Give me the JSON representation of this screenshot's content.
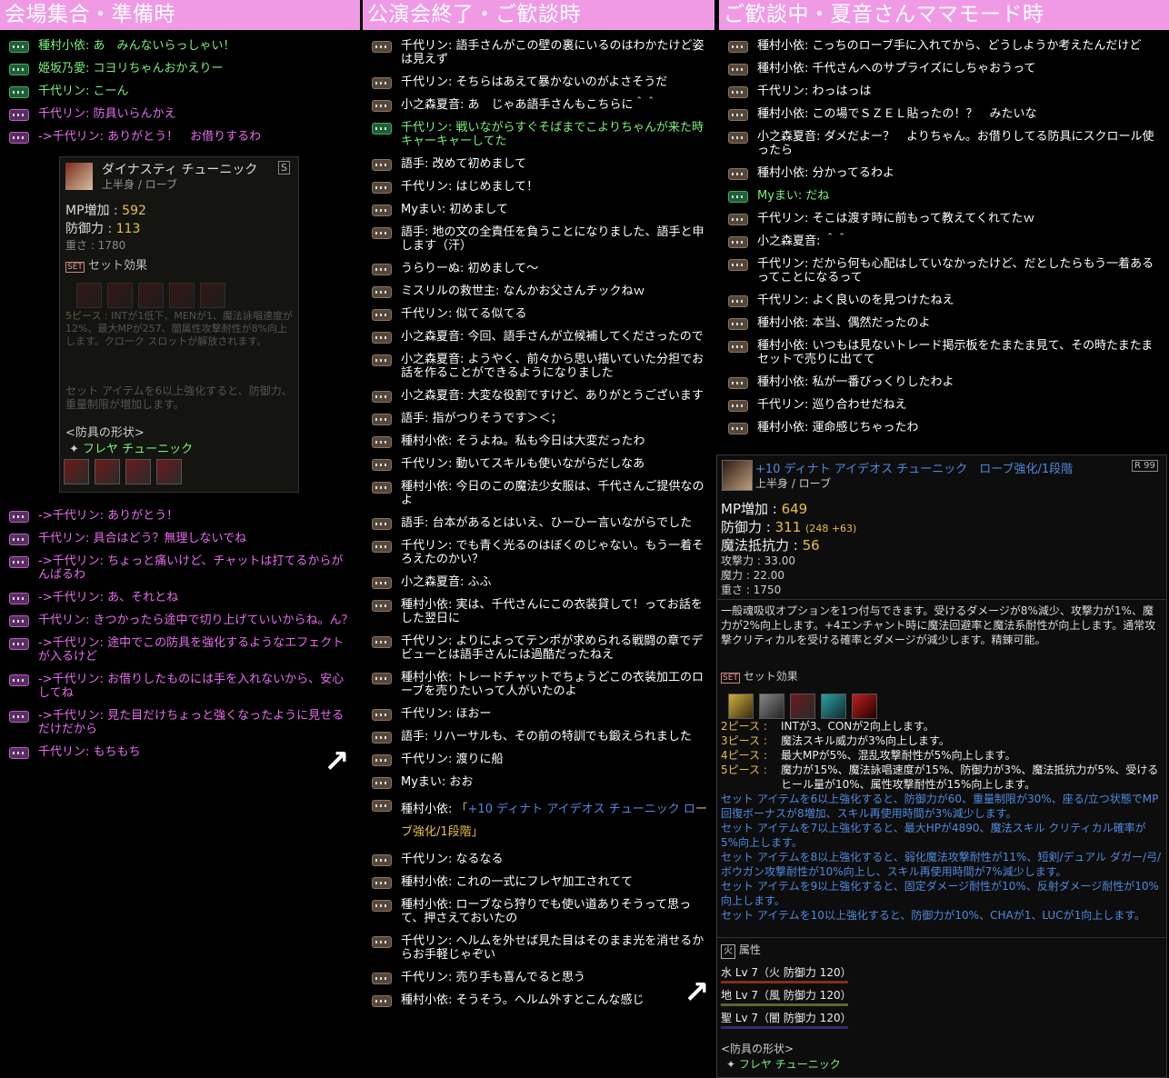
{
  "columns": [
    {
      "header": "会場集合・準備時",
      "messages_top": [
        {
          "icon": "g",
          "color": "green",
          "text": "種村小依: あ　みんないらっしゃい！"
        },
        {
          "icon": "g",
          "color": "green",
          "text": "姫坂乃愛: コヨリちゃんおかえりー"
        },
        {
          "icon": "g",
          "color": "green",
          "text": "千代リン: こーん"
        },
        {
          "icon": "p",
          "color": "pink",
          "text": "千代リン: 防具いらんかえ"
        },
        {
          "icon": "p",
          "color": "pink",
          "text": "->千代リン: ありがとう！　お借りするわ"
        }
      ],
      "messages_bottom": [
        {
          "icon": "p",
          "color": "pink",
          "text": "->千代リン: ありがとう！"
        },
        {
          "icon": "p",
          "color": "pink",
          "text": "千代リン: 具合はどう？無理しないでね"
        },
        {
          "icon": "p",
          "color": "pink",
          "text": "->千代リン: ちょっと痛いけど、チャットは打てるからがんばるわ"
        },
        {
          "icon": "p",
          "color": "pink",
          "text": "->千代リン: あ、それとね"
        },
        {
          "icon": "p",
          "color": "pink",
          "text": "千代リン: きつかったら途中で切り上げていいからね。ん？"
        },
        {
          "icon": "p",
          "color": "pink",
          "text": "->千代リン: 途中でこの防具を強化するようなエフェクトが入るけど"
        },
        {
          "icon": "p",
          "color": "pink",
          "text": "->千代リン: お借りしたものには手を入れないから、安心してね"
        },
        {
          "icon": "p",
          "color": "pink",
          "text": "->千代リン: 見た目だけちょっと強くなったように見せるだけだから"
        },
        {
          "icon": "p",
          "color": "pink",
          "text": "千代リン: もちもち"
        }
      ]
    },
    {
      "header": "公演会終了・ご歓談時",
      "messages": [
        {
          "icon": "w",
          "color": "white",
          "text": "千代リン: 語手さんがこの壁の裏にいるのはわかたけど姿は見えず"
        },
        {
          "icon": "w",
          "color": "white",
          "text": "千代リン: そちらはあえて暴かないのがよさそうだ"
        },
        {
          "icon": "w",
          "color": "white",
          "text": "小之森夏音: あ　じゃあ語手さんもこちらに＾＾"
        },
        {
          "icon": "g",
          "color": "green",
          "text": "千代リン: 戦いながらすぐそばまでこよりちゃんが来た時キャーキャーしてた"
        },
        {
          "icon": "w",
          "color": "white",
          "text": "語手: 改めて初めまして"
        },
        {
          "icon": "w",
          "color": "white",
          "text": "千代リン: はじめまして！"
        },
        {
          "icon": "w",
          "color": "white",
          "text": "Myまい: 初めまして"
        },
        {
          "icon": "w",
          "color": "white",
          "text": "語手: 地の文の全責任を負うことになりました、語手と申します（汗）"
        },
        {
          "icon": "w",
          "color": "white",
          "text": "うらりーぬ: 初めまして〜"
        },
        {
          "icon": "w",
          "color": "white",
          "text": "ミスリルの救世主: なんかお父さんチックねｗ"
        },
        {
          "icon": "w",
          "color": "white",
          "text": "千代リン: 似てる似てる"
        },
        {
          "icon": "w",
          "color": "white",
          "text": "小之森夏音: 今回、語手さんが立候補してくださったので"
        },
        {
          "icon": "w",
          "color": "white",
          "text": "小之森夏音: ようやく、前々から思い描いていた分担でお話を作ることができるようになりました"
        },
        {
          "icon": "w",
          "color": "white",
          "text": "小之森夏音: 大変な役割ですけど、ありがとうございます"
        },
        {
          "icon": "w",
          "color": "white",
          "text": "語手: 指がつりそうです＞＜；"
        },
        {
          "icon": "w",
          "color": "white",
          "text": "種村小依: そうよね。私も今日は大変だったわ"
        },
        {
          "icon": "w",
          "color": "white",
          "text": "千代リン: 動いてスキルも使いながらだしなあ"
        },
        {
          "icon": "w",
          "color": "white",
          "text": "種村小依: 今日のこの魔法少女服は、千代さんご提供なのよ"
        },
        {
          "icon": "w",
          "color": "white",
          "text": "語手: 台本があるとはいえ、ひーひー言いながらでした"
        },
        {
          "icon": "w",
          "color": "white",
          "text": "千代リン: でも青く光るのはぼくのじゃない。もう一着そろえたのかい？"
        },
        {
          "icon": "w",
          "color": "white",
          "text": "小之森夏音: ふふ"
        },
        {
          "icon": "w",
          "color": "white",
          "text": "種村小依: 実は、千代さんにこの衣装貸して！ってお話をした翌日に"
        },
        {
          "icon": "w",
          "color": "white",
          "text": "千代リン: よりによってテンポが求められる戦闘の章でデビューとは語手さんには過酷だったねえ"
        },
        {
          "icon": "w",
          "color": "white",
          "text": "種村小依: トレードチャットでちょうどこの衣装加工のローブを売りたいって人がいたのよ"
        },
        {
          "icon": "w",
          "color": "white",
          "text": "千代リン: ほおー"
        },
        {
          "icon": "w",
          "color": "white",
          "text": "語手: リハーサルも、その前の特訓でも鍛えられました"
        },
        {
          "icon": "w",
          "color": "white",
          "text": "千代リン: 渡りに船"
        },
        {
          "icon": "w",
          "color": "white",
          "text": "Myまい: おお"
        }
      ],
      "link_msg": {
        "prefix": "種村小依: ",
        "open": "「",
        "link1": "+10 ディナト アイデオス チューニック ロ",
        "link2": "ーブ強化/1段階",
        "close": "」"
      },
      "messages_after": [
        {
          "icon": "w",
          "color": "white",
          "text": "千代リン: なるなる"
        },
        {
          "icon": "w",
          "color": "white",
          "text": "種村小依: これの一式にフレヤ加工されてて"
        },
        {
          "icon": "w",
          "color": "white",
          "text": "種村小依: ローブなら狩りでも使い道ありそうって思って、押さえておいたの"
        },
        {
          "icon": "w",
          "color": "white",
          "text": "千代リン: ヘルムを外せば見た目はそのまま光を消せるからお手軽じゃぞい"
        },
        {
          "icon": "w",
          "color": "white",
          "text": "千代リン: 売り手も喜んでると思う"
        },
        {
          "icon": "w",
          "color": "white",
          "text": "種村小依: そうそう。ヘルム外すとこんな感じ"
        }
      ]
    },
    {
      "header": "ご歓談中・夏音さんママモード時",
      "messages": [
        {
          "icon": "w",
          "color": "white",
          "text": "種村小依: こっちのローブ手に入れてから、どうしようか考えたんだけど"
        },
        {
          "icon": "w",
          "color": "white",
          "text": "種村小依: 千代さんへのサプライズにしちゃおうって"
        },
        {
          "icon": "w",
          "color": "white",
          "text": "千代リン: わっはっは"
        },
        {
          "icon": "w",
          "color": "white",
          "text": "種村小依: この場でＳＺＥＬ貼ったの！？　みたいな"
        },
        {
          "icon": "w",
          "color": "white",
          "text": "小之森夏音: ダメだよー？　よりちゃん。お借りしてる防具にスクロール使ったら"
        },
        {
          "icon": "w",
          "color": "white",
          "text": "種村小依: 分かってるわよ"
        },
        {
          "icon": "g",
          "color": "green",
          "text": "Myまい: だね"
        },
        {
          "icon": "w",
          "color": "white",
          "text": "千代リン: そこは渡す時に前もって教えてくれてたｗ"
        },
        {
          "icon": "w",
          "color": "white",
          "text": "小之森夏音: ＾＾"
        },
        {
          "icon": "w",
          "color": "white",
          "text": "千代リン: だから何も心配はしていなかったけど、だとしたらもう一着あるってことになるって"
        },
        {
          "icon": "w",
          "color": "white",
          "text": "千代リン: よく良いのを見つけたねえ"
        },
        {
          "icon": "w",
          "color": "white",
          "text": "種村小依: 本当、偶然だったのよ"
        },
        {
          "icon": "w",
          "color": "white",
          "text": "種村小依: いつもは見ないトレード掲示板をたまたま見て、その時たまたまセットで売りに出てて"
        },
        {
          "icon": "w",
          "color": "white",
          "text": "種村小依: 私が一番びっくりしたわよ"
        },
        {
          "icon": "w",
          "color": "white",
          "text": "千代リン: 巡り合わせだねえ"
        },
        {
          "icon": "w",
          "color": "white",
          "text": "種村小依: 運命感じちゃったわ"
        }
      ]
    }
  ],
  "tooltip_left": {
    "name": "ダイナスティ チューニック",
    "badge": "S",
    "slot": "上半身 / ローブ",
    "stats": [
      {
        "label": "MP増加",
        "value": "592"
      },
      {
        "label": "防御力",
        "value": "113"
      }
    ],
    "weight": "重さ : 1780",
    "set_title": "セット効果",
    "piece_label": "5ピース :",
    "piece_text": "INTが1低下、MENが1、魔法詠唱速度が12%、最大MPが257、闇属性攻撃耐性が8%向上します。クローク スロットが解放されます。",
    "enhance_text": "セット アイテムを6以上強化すると、防御力、重量制限が増加します。",
    "shape_title": "<防具の形状>",
    "shape_name": "フレヤ チューニック"
  },
  "tooltip_right": {
    "name": "+10 ディナト アイデオス チューニック　ローブ強化/1段階",
    "badge": "R 99",
    "slot": "上半身 / ローブ",
    "stats_big": [
      {
        "label": "MP増加 :",
        "value": "649",
        "extra": ""
      },
      {
        "label": "防御力 :",
        "value": "311",
        "extra": "(248 +63)"
      },
      {
        "label": "魔法抵抗力 :",
        "value": "56",
        "extra": ""
      }
    ],
    "stats_small": [
      "攻撃力 : 33.00",
      "魔力 : 22.00",
      "重さ : 1750"
    ],
    "desc": "一般魂吸収オプションを1つ付与できます。受けるダメージが8%減少、攻撃力が1%、魔力が2%向上します。+4エンチャント時に魔法回避率と魔法系耐性が向上します。通常攻撃クリティカルを受ける確率とダメージが減少します。精錬可能。",
    "set_title": "セット効果",
    "pieces": [
      {
        "label": "2ピース :",
        "text": "INTが3、CONが2向上します。"
      },
      {
        "label": "3ピース :",
        "text": "魔法スキル威力が3%向上します。"
      },
      {
        "label": "4ピース :",
        "text": "最大MPが5%、混乱攻撃耐性が5%向上します。"
      },
      {
        "label": "5ピース :",
        "text": "魔力が15%、魔法詠唱速度が15%、防御力が3%、魔法抵抗力が5%、受けるヒール量が10%、属性攻撃耐性が15%向上します。"
      }
    ],
    "enhance": [
      "セット アイテムを6以上強化すると、防御力が60、重量制限が30%、座る/立つ状態でMP回復ボーナスが8増加、スキル再使用時間が3%減少します。",
      "セット アイテムを7以上強化すると、最大HPが4890、魔法スキル クリティカル確率が5%向上します。",
      "セット アイテムを8以上強化すると、弱化魔法攻撃耐性が11%、短剣/デュアル ダガー/弓/ボウガン攻撃耐性が10%向上し、スキル再使用時間が7%減少します。",
      "セット アイテムを9以上強化すると、固定ダメージ耐性が10%、反射ダメージ耐性が10%向上します。",
      "セット アイテムを10以上強化すると、防御力が10%、CHAが1、LUCが1向上します。"
    ],
    "attr_title": "属性",
    "attrs": [
      {
        "text": "水 Lv 7（火 防御力 120）",
        "color": "#8a2a1a"
      },
      {
        "text": "地 Lv 7（風 防御力 120）",
        "color": "#5a6a2a"
      },
      {
        "text": "聖 Lv 7（闇 防御力 120）",
        "color": "#3a2a6a"
      }
    ],
    "shape_title": "<防具の形状>",
    "shape_name": "フレヤ チューニック"
  },
  "arrows": [
    "↗",
    "↗"
  ],
  "colors": {
    "header": "#f09ae6",
    "green": "#7cf27c",
    "pink": "#ea6cf0",
    "yellow": "#e8c040",
    "blue": "#4f8be0"
  }
}
